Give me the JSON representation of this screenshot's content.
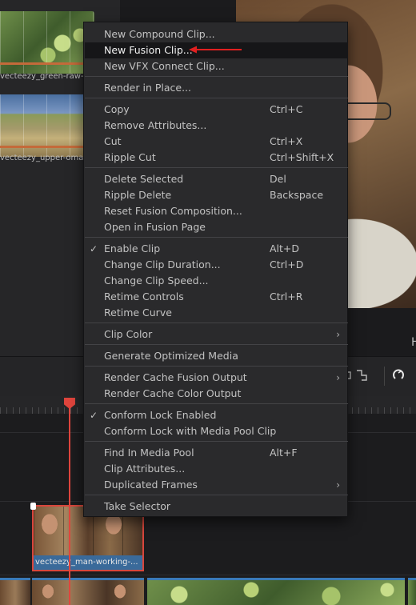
{
  "media_pool": {
    "clips": [
      {
        "label": "vecteezy_green-raw-m"
      },
      {
        "label": "vecteezy_upper-oma"
      }
    ]
  },
  "viewer": {
    "corner_letter": "H"
  },
  "timeline": {
    "selected_clip_label": "vecteezy_man-working-..."
  },
  "context_menu": {
    "items": [
      {
        "label": "New Compound Clip...",
        "shortcut": ""
      },
      {
        "label": "New Fusion Clip...",
        "shortcut": ""
      },
      {
        "label": "New VFX Connect Clip...",
        "shortcut": ""
      },
      {
        "label": "Render in Place...",
        "shortcut": ""
      },
      {
        "label": "Copy",
        "shortcut": "Ctrl+C"
      },
      {
        "label": "Remove Attributes...",
        "shortcut": ""
      },
      {
        "label": "Cut",
        "shortcut": "Ctrl+X"
      },
      {
        "label": "Ripple Cut",
        "shortcut": "Ctrl+Shift+X"
      },
      {
        "label": "Delete Selected",
        "shortcut": "Del"
      },
      {
        "label": "Ripple Delete",
        "shortcut": "Backspace"
      },
      {
        "label": "Reset Fusion Composition...",
        "shortcut": ""
      },
      {
        "label": "Open in Fusion Page",
        "shortcut": ""
      },
      {
        "label": "Enable Clip",
        "shortcut": "Alt+D",
        "checked": true
      },
      {
        "label": "Change Clip Duration...",
        "shortcut": "Ctrl+D"
      },
      {
        "label": "Change Clip Speed...",
        "shortcut": ""
      },
      {
        "label": "Retime Controls",
        "shortcut": "Ctrl+R"
      },
      {
        "label": "Retime Curve",
        "shortcut": ""
      },
      {
        "label": "Clip Color",
        "shortcut": "",
        "submenu": true
      },
      {
        "label": "Generate Optimized Media",
        "shortcut": ""
      },
      {
        "label": "Render Cache Fusion Output",
        "shortcut": "",
        "submenu": true
      },
      {
        "label": "Render Cache Color Output",
        "shortcut": ""
      },
      {
        "label": "Conform Lock Enabled",
        "shortcut": "",
        "checked": true
      },
      {
        "label": "Conform Lock with Media Pool Clip",
        "shortcut": ""
      },
      {
        "label": "Find In Media Pool",
        "shortcut": "Alt+F"
      },
      {
        "label": "Clip Attributes...",
        "shortcut": ""
      },
      {
        "label": "Duplicated Frames",
        "shortcut": "",
        "submenu": true
      },
      {
        "label": "Take Selector",
        "shortcut": ""
      }
    ],
    "highlighted_index": 1,
    "check_glyph": "✓",
    "submenu_glyph": "›"
  },
  "annotation": {
    "arrow_color": "#e02020"
  },
  "colors": {
    "playhead": "#e0453d",
    "selected_clip_border": "#d8463c",
    "clip_label_bg": "#3a6a9a"
  }
}
